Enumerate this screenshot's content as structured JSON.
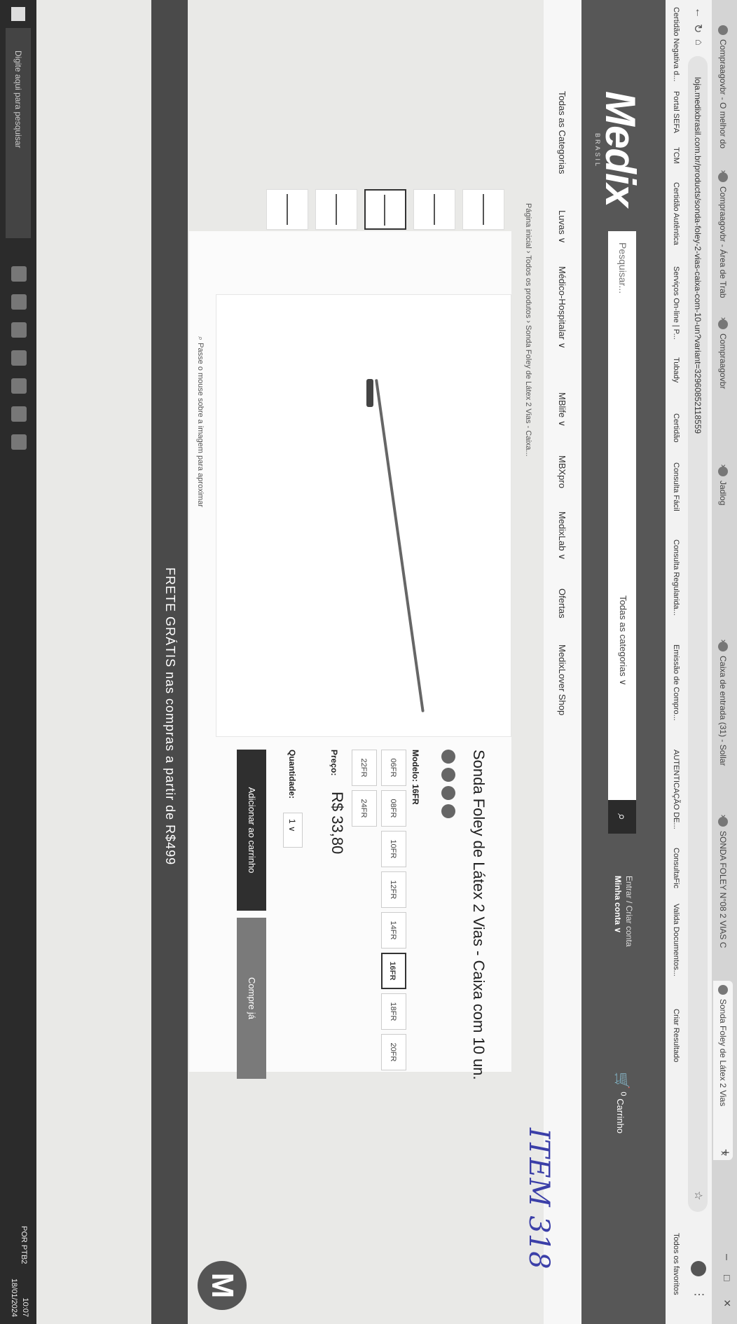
{
  "browser": {
    "tabs": [
      {
        "label": "Compraagovbr - O melhor do"
      },
      {
        "label": "Compraagovbr - Área de Trab"
      },
      {
        "label": "Compraagovbr"
      },
      {
        "label": "Jadlog"
      },
      {
        "label": "Caixa de entrada (31) - Sollar"
      },
      {
        "label": "SONDA FOLEY N°08 2 VIAS C"
      },
      {
        "label": "Sonda Foley de Látex 2 Vias"
      }
    ],
    "url": "loja.medixbrasil.com.br/products/sonda-foley-2-vias-caixa-com-10-un?variant=32960852118559",
    "bookmarks": [
      "Certidão Negativa d...",
      "Portal SEFA",
      "TCM",
      "Certidão Autêntica",
      "Serviços On-line | P...",
      "Tubady",
      "Certidão",
      "Consulta Fácil",
      "Consulta Regularida...",
      "Emissão de Compro...",
      "AUTENTICAÇÃO DE...",
      "ConsultaFic",
      "Valida Documentos...",
      "Criar Resultado",
      "Todos os favoritos"
    ]
  },
  "site": {
    "logo": "Medix",
    "logo_sub": "BRASIL",
    "search_placeholder": "Pesquisar...",
    "search_category": "Todas as categorias ∨",
    "account_line1": "Entrar / Criar conta",
    "account_line2": "Minha conta ∨",
    "cart_label": "Carrinho",
    "cart_count": "0",
    "nav": [
      "Todas as Categorias",
      "Luvas ∨",
      "Médico-Hospitalar ∨",
      "MBlife ∨",
      "MBXpro",
      "MedixLab ∨",
      "Ofertas",
      "MedixLover Shop"
    ],
    "breadcrumb": "Página inicial › Todos os produtos › Sonda Foley de Látex 2 Vias - Caixa..."
  },
  "product": {
    "title": "Sonda Foley de Látex 2 Vias - Caixa com 10 un.",
    "model_label": "Modelo: 16FR",
    "sizes": [
      "06FR",
      "08FR",
      "10FR",
      "12FR",
      "14FR",
      "16FR",
      "18FR",
      "20FR",
      "22FR",
      "24FR"
    ],
    "selected_size": "16FR",
    "price_label": "Preço:",
    "price": "R$ 33,80",
    "qty_label": "Quantidade:",
    "qty": "1 ∨",
    "add_to_cart": "Adicionar ao carrinho",
    "buy_now": "Compre já",
    "zoom_hint": "Passe o mouse sobre a imagem para aproximar"
  },
  "annotation": "ITEM 318",
  "free_shipping": "FRETE GRÁTIS nas compras a partir de R$499",
  "taskbar": {
    "search_placeholder": "Digite aqui para pesquisar",
    "lang": "POR PTB2",
    "time": "10:07",
    "date": "18/01/2024"
  }
}
